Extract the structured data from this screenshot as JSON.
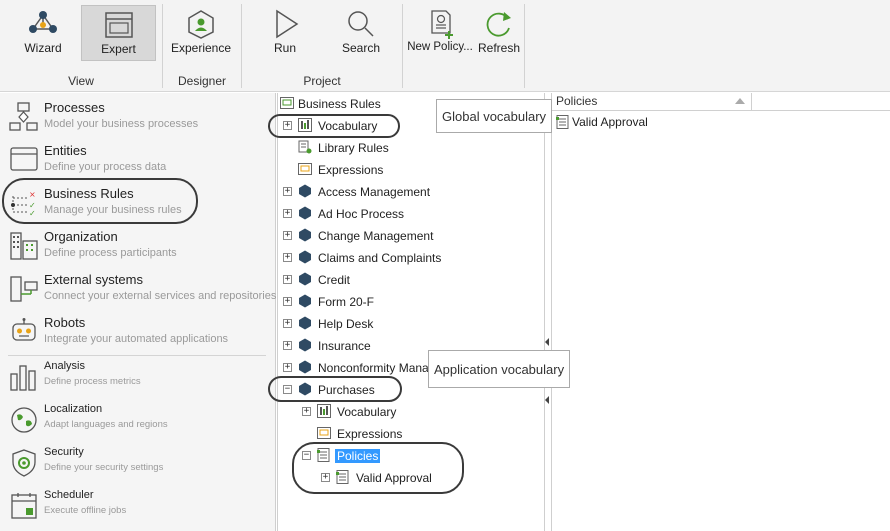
{
  "ribbon": {
    "buttons": {
      "wizard": "Wizard",
      "expert": "Expert",
      "experience": "Experience",
      "run": "Run",
      "search": "Search",
      "new_policy": "New Policy...",
      "refresh": "Refresh"
    },
    "groups": {
      "view": "View",
      "designer": "Designer",
      "project": "Project"
    }
  },
  "leftnav": {
    "items": [
      {
        "title": "Processes",
        "subtitle": "Model your business processes"
      },
      {
        "title": "Entities",
        "subtitle": "Define your process data"
      },
      {
        "title": "Business Rules",
        "subtitle": "Manage your business rules"
      },
      {
        "title": "Organization",
        "subtitle": "Define process participants"
      },
      {
        "title": "External systems",
        "subtitle": "Connect your external services and repositories"
      },
      {
        "title": "Robots",
        "subtitle": "Integrate your automated applications"
      },
      {
        "title": "Analysis",
        "subtitle": "Define process metrics"
      },
      {
        "title": "Localization",
        "subtitle": "Adapt languages and regions"
      },
      {
        "title": "Security",
        "subtitle": "Define your security settings"
      },
      {
        "title": "Scheduler",
        "subtitle": "Execute offline jobs"
      }
    ]
  },
  "tree": {
    "root": "Business Rules",
    "nodes": [
      "Vocabulary",
      "Library Rules",
      "Expressions",
      "Access Management",
      "Ad Hoc Process",
      "Change Management",
      "Claims and Complaints",
      "Credit",
      "Form 20-F",
      "Help Desk",
      "Insurance",
      "Nonconformity Management",
      "Purchases",
      "Vocabulary",
      "Expressions",
      "Policies",
      "Valid Approval"
    ]
  },
  "rightpanel": {
    "column_header": "Policies",
    "items": [
      "Valid Approval"
    ]
  },
  "callouts": {
    "global": "Global vocabulary",
    "application": "Application vocabulary"
  },
  "colors": {
    "accent": "#4a9a2e",
    "selection": "#3399ff",
    "hexagon": "#2f4a63"
  }
}
